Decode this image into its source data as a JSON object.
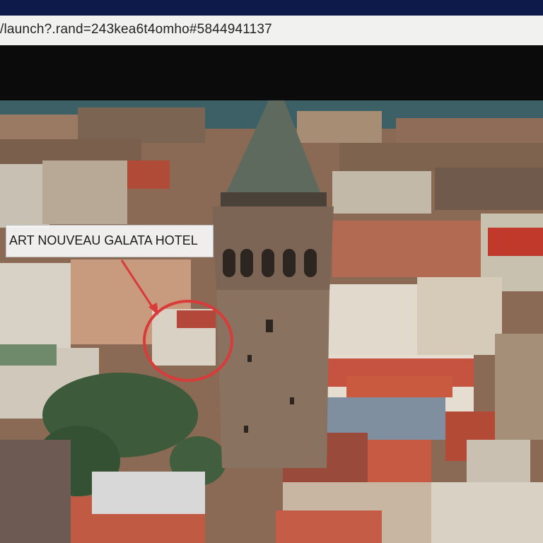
{
  "address_bar": {
    "url_text": "/launch?.rand=243kea6t4omho#5844941137"
  },
  "annotation": {
    "label": "ART NOUVEAU GALATA HOTEL",
    "marker_color": "#d93a3a"
  },
  "colors": {
    "sea": "#3d5f66",
    "roof": "#b9452f",
    "tower": "#8a7260",
    "tower_roof": "#5e6a5e"
  }
}
